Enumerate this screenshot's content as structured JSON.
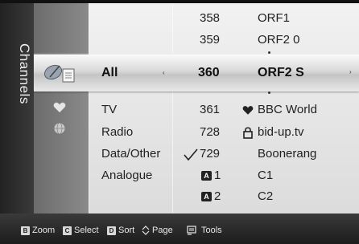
{
  "title": "Channels",
  "groups": [
    {
      "label": "All",
      "arrow": "‹"
    },
    {
      "label": "TV"
    },
    {
      "label": "Radio"
    },
    {
      "label": "Data/Other"
    },
    {
      "label": "Analogue"
    }
  ],
  "channels": [
    {
      "number": "358",
      "name": "ORF1"
    },
    {
      "number": "359",
      "name": "ORF2 0"
    },
    {
      "number": "360",
      "name": "ORF2 S"
    },
    {
      "number": "361",
      "name": "BBC World",
      "mark": "heart"
    },
    {
      "number": "728",
      "name": "bid-up.tv",
      "mark": "lock"
    },
    {
      "number": "729",
      "name": "Boonerang",
      "mark": "check"
    },
    {
      "number": "1",
      "name": "C1",
      "mark": "analog"
    },
    {
      "number": "2",
      "name": "C2",
      "mark": "analog"
    }
  ],
  "analog_badge": "A",
  "footer": {
    "zoom": {
      "key": "B",
      "label": "Zoom"
    },
    "select": {
      "key": "C",
      "label": "Select"
    },
    "sort": {
      "key": "D",
      "label": "Sort"
    },
    "page": {
      "label": "Page"
    },
    "tools": {
      "label": "Tools"
    }
  },
  "right_arrow": "›"
}
